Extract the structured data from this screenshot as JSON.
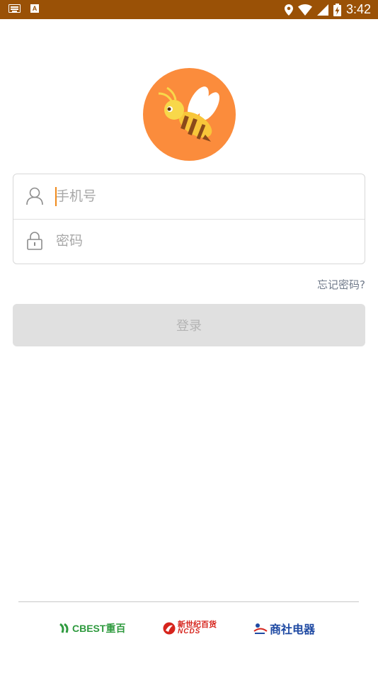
{
  "status_bar": {
    "time": "3:42",
    "icons": [
      "keyboard-icon",
      "text-a-icon",
      "location-icon",
      "wifi-icon",
      "signal-icon",
      "battery-charging-icon"
    ],
    "notification_letter": "A"
  },
  "app": {
    "logo": "bee-logo",
    "accent_color": "#fb8c3c",
    "status_bar_color": "#9a5106"
  },
  "login": {
    "phone_placeholder": "手机号",
    "phone_value": "",
    "password_placeholder": "密码",
    "password_value": "",
    "forgot_label": "忘记密码?",
    "submit_label": "登录"
  },
  "footer": {
    "brands": [
      {
        "name": "CBEST重百",
        "icon": "cbest-logo-icon"
      },
      {
        "name": "新世纪百货",
        "sub": "NCDS",
        "icon": "ncds-logo-icon"
      },
      {
        "name": "商社电器",
        "icon": "shangshe-logo-icon"
      }
    ]
  }
}
